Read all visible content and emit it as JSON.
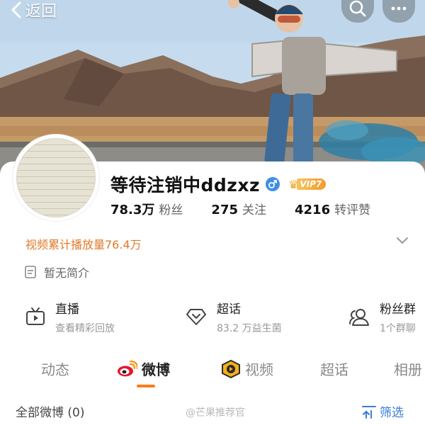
{
  "nav": {
    "back_label": "返回"
  },
  "profile": {
    "username": "等待注销中ddzxz",
    "vip_label": "VIP7",
    "stats": {
      "fans_count": "78.3万",
      "fans_label": "粉丝",
      "following_count": "275",
      "following_label": "关注",
      "likes_count": "4216",
      "likes_label": "转评赞"
    },
    "video_plays": "视频累计播放量76.4万",
    "bio": "暂无简介"
  },
  "services": [
    {
      "title": "直播",
      "subtitle": "查看精彩回放",
      "icon": "tv-icon"
    },
    {
      "title": "超话",
      "subtitle": "83.2 万益生菌",
      "icon": "diamond-icon"
    },
    {
      "title": "粉丝群",
      "subtitle": "1个群聊",
      "icon": "group-icon"
    }
  ],
  "tabs": [
    {
      "label": "动态"
    },
    {
      "label": "微博",
      "active": true,
      "icon": "weibo-icon"
    },
    {
      "label": "视频",
      "icon": "video-icon"
    },
    {
      "label": "超话"
    },
    {
      "label": "相册"
    }
  ],
  "feed": {
    "all_weibo_label": "全部微博 (0)",
    "filter_label": "筛选",
    "watermark": "@芒果推荐官"
  },
  "colors": {
    "accent_orange": "#ff7b1c",
    "plays_orange": "#e07a2c",
    "link_blue": "#3a7bd5",
    "gender_blue": "#3f8fe6"
  }
}
